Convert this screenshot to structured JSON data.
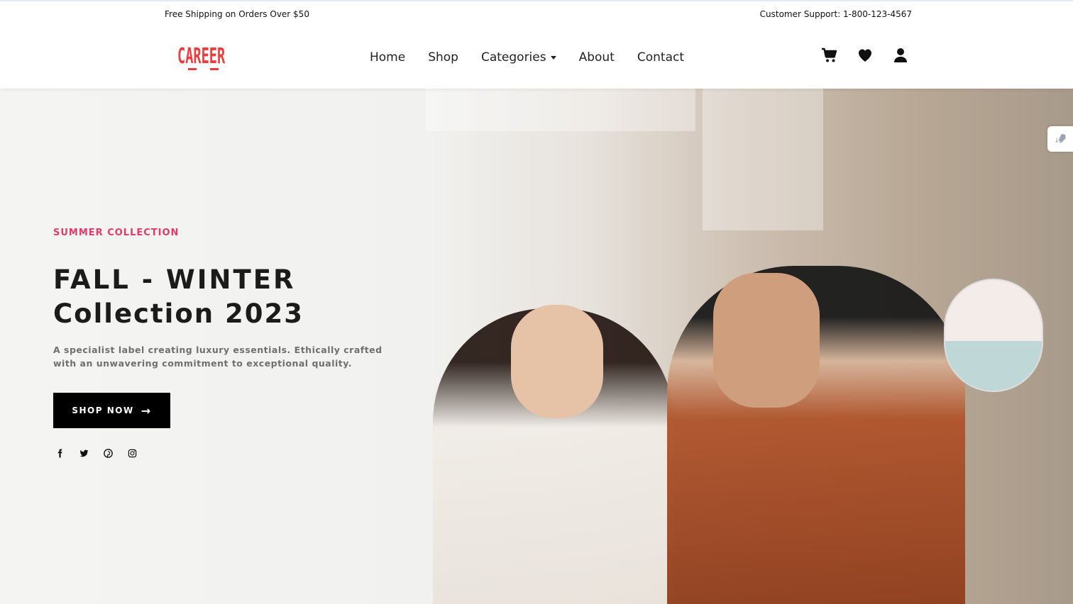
{
  "topbar": {
    "left_text": "Free Shipping on Orders Over $50",
    "right_text": "Customer Support: 1-800-123-4567"
  },
  "brand": {
    "logo_text": "CAREER",
    "accent_color": "#ef3b3b"
  },
  "nav": {
    "items": [
      {
        "label": "Home"
      },
      {
        "label": "Shop"
      },
      {
        "label": "Categories"
      },
      {
        "label": "About"
      },
      {
        "label": "Contact"
      }
    ],
    "icons": [
      "cart-icon",
      "heart-icon",
      "user-icon"
    ]
  },
  "hero": {
    "kicker": "SUMMER COLLECTION",
    "title_line1": "FALL - WINTER",
    "title_line2": "Collection 2023",
    "description": "A specialist label creating luxury essentials. Ethically crafted with an unwavering commitment to exceptional quality.",
    "cta_label": "SHOP NOW",
    "kicker_color": "#e23a6b",
    "social_icons": [
      "facebook-icon",
      "twitter-icon",
      "pinterest-icon",
      "instagram-icon"
    ]
  }
}
